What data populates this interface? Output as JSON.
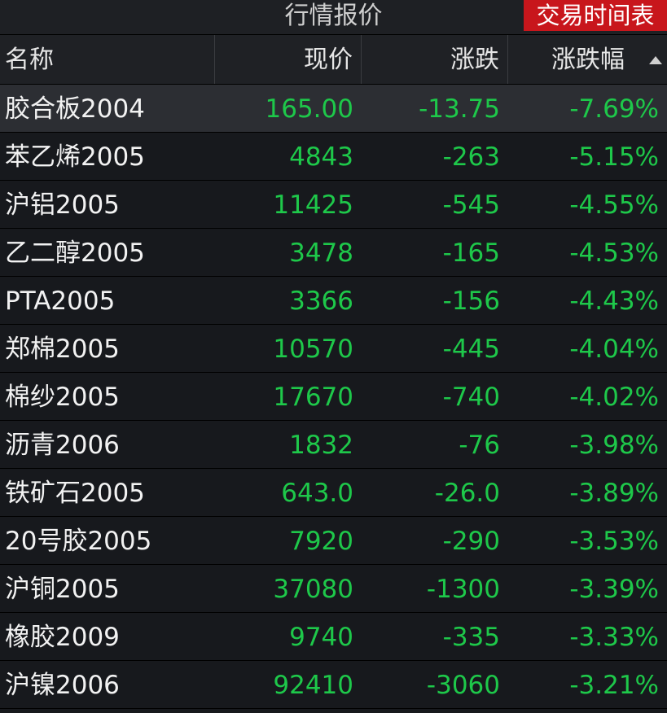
{
  "topbar": {
    "title": "行情报价",
    "schedule_label": "交易时间表"
  },
  "colors": {
    "down": "#1ec84a",
    "accent": "#c8161c",
    "background": "#17191d"
  },
  "columns": {
    "name": "名称",
    "price": "现价",
    "change": "涨跌",
    "pct": "涨跌幅",
    "sort_icon": "sort-ascending-triangle-icon"
  },
  "rows": [
    {
      "name": "胶合板2004",
      "price": "165.00",
      "change": "-13.75",
      "pct": "-7.69%"
    },
    {
      "name": "苯乙烯2005",
      "price": "4843",
      "change": "-263",
      "pct": "-5.15%"
    },
    {
      "name": "沪铝2005",
      "price": "11425",
      "change": "-545",
      "pct": "-4.55%"
    },
    {
      "name": "乙二醇2005",
      "price": "3478",
      "change": "-165",
      "pct": "-4.53%"
    },
    {
      "name": "PTA2005",
      "price": "3366",
      "change": "-156",
      "pct": "-4.43%"
    },
    {
      "name": "郑棉2005",
      "price": "10570",
      "change": "-445",
      "pct": "-4.04%"
    },
    {
      "name": "棉纱2005",
      "price": "17670",
      "change": "-740",
      "pct": "-4.02%"
    },
    {
      "name": "沥青2006",
      "price": "1832",
      "change": "-76",
      "pct": "-3.98%"
    },
    {
      "name": "铁矿石2005",
      "price": "643.0",
      "change": "-26.0",
      "pct": "-3.89%"
    },
    {
      "name": "20号胶2005",
      "price": "7920",
      "change": "-290",
      "pct": "-3.53%"
    },
    {
      "name": "沪铜2005",
      "price": "37080",
      "change": "-1300",
      "pct": "-3.39%"
    },
    {
      "name": "橡胶2009",
      "price": "9740",
      "change": "-335",
      "pct": "-3.33%"
    },
    {
      "name": "沪镍2006",
      "price": "92410",
      "change": "-3060",
      "pct": "-3.21%"
    }
  ]
}
